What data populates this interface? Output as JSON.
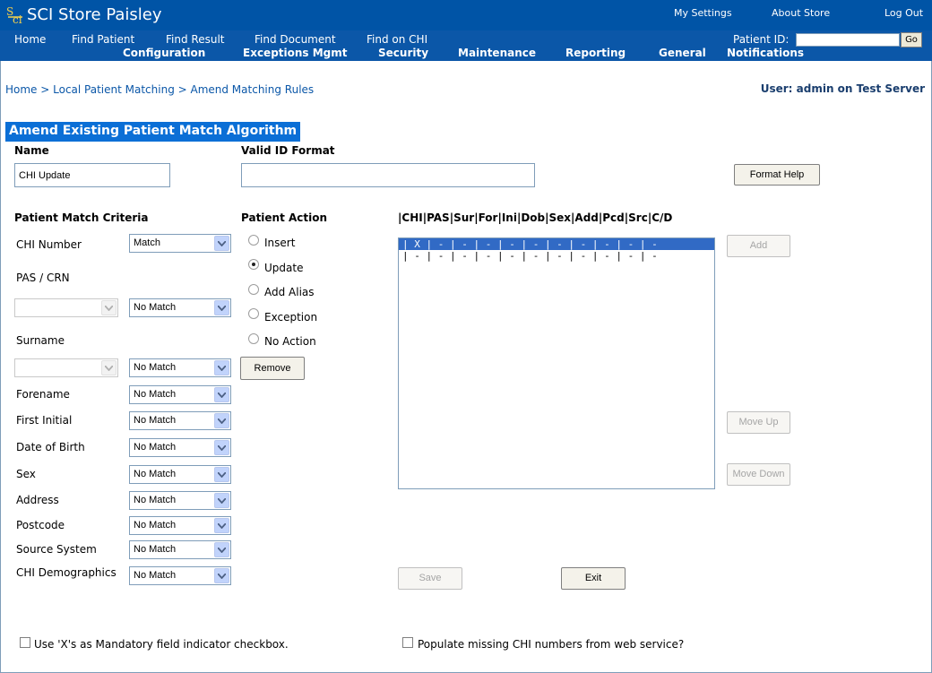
{
  "header": {
    "app_title": "SCI Store Paisley",
    "top_links": [
      "My Settings",
      "About Store",
      "Log Out"
    ]
  },
  "nav": {
    "primary": [
      "Home",
      "Find Patient",
      "Find Result",
      "Find Document",
      "Find on CHI"
    ],
    "secondary": [
      "Configuration",
      "Exceptions Mgmt",
      "Security",
      "Maintenance",
      "Reporting",
      "General",
      "Notifications"
    ],
    "patient_id_label": "Patient ID:",
    "patient_id_value": "",
    "go_label": "Go"
  },
  "breadcrumb": "Home > Local Patient Matching > Amend Matching Rules",
  "user_info": "User: admin on Test Server",
  "form": {
    "section_title": "Amend Existing Patient Match Algorithm",
    "name_label": "Name",
    "name_value": "CHI Update",
    "valid_id_label": "Valid ID Format",
    "valid_id_value": "",
    "format_help_label": "Format Help",
    "criteria_header": "Patient Match Criteria",
    "action_header": "Patient Action",
    "columns_header": "|CHI|PAS|Sur|For|Ini|Dob|Sex|Add|Pcd|Src|C/D",
    "criteria": {
      "chi_number": {
        "label": "CHI Number",
        "value": "Match"
      },
      "pas_crn": {
        "label": "PAS / CRN",
        "type_value": "",
        "value": "No Match"
      },
      "surname": {
        "label": "Surname",
        "type_value": "",
        "value": "No Match"
      },
      "forename": {
        "label": "Forename",
        "value": "No Match"
      },
      "first_initial": {
        "label": "First Initial",
        "value": "No Match"
      },
      "date_of_birth": {
        "label": "Date of Birth",
        "value": "No Match"
      },
      "sex": {
        "label": "Sex",
        "value": "No Match"
      },
      "address": {
        "label": "Address",
        "value": "No Match"
      },
      "postcode": {
        "label": "Postcode",
        "value": "No Match"
      },
      "source_system": {
        "label": "Source System",
        "value": "No Match"
      },
      "chi_demographics": {
        "label": "CHI Demographics",
        "value": "No Match"
      }
    },
    "actions": {
      "insert": "Insert",
      "update": "Update",
      "add_alias": "Add Alias",
      "exception": "Exception",
      "no_action": "No Action",
      "selected": "Update"
    },
    "remove_label": "Remove",
    "rules": [
      "| X | - | - | - | - | - | - | - | - | - | -",
      "| - | - | - | - | - | - | - | - | - | - | -"
    ],
    "add_label": "Add",
    "move_up_label": "Move Up",
    "move_down_label": "Move Down",
    "save_label": "Save",
    "exit_label": "Exit",
    "mandatory_checkbox_label": "Use 'X's as Mandatory field indicator checkbox.",
    "populate_checkbox_label": "Populate missing CHI numbers from web service?"
  }
}
